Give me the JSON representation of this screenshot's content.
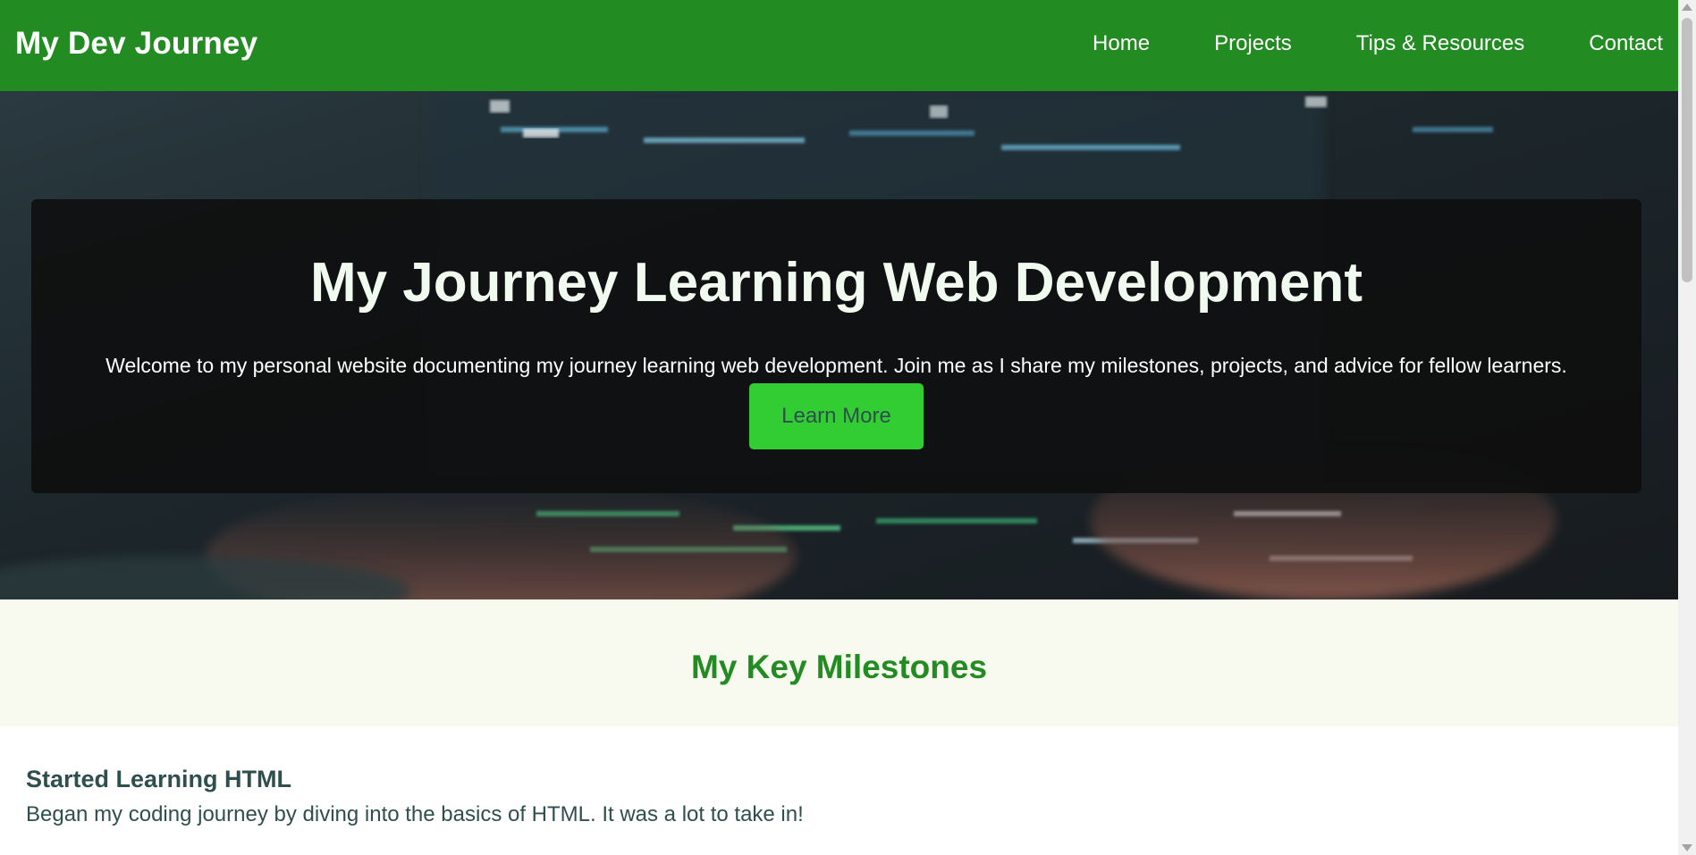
{
  "header": {
    "brand": "My Dev Journey",
    "nav": [
      {
        "label": "Home"
      },
      {
        "label": "Projects"
      },
      {
        "label": "Tips & Resources"
      },
      {
        "label": "Contact"
      }
    ]
  },
  "hero": {
    "title": "My Journey Learning Web Development",
    "text": "Welcome to my personal website documenting my journey learning web development. Join me as I share my milestones, projects, and advice for fellow learners.",
    "button": "Learn More"
  },
  "milestones": {
    "title": "My Key Milestones",
    "items": [
      {
        "title": "Started Learning HTML",
        "text": "Began my coding journey by diving into the basics of HTML. It was a lot to take in!"
      }
    ]
  },
  "colors": {
    "primary": "#228b22",
    "accent": "#32cd32",
    "text_dark": "#2f4f4f",
    "section_bg": "#f8f9ef"
  }
}
